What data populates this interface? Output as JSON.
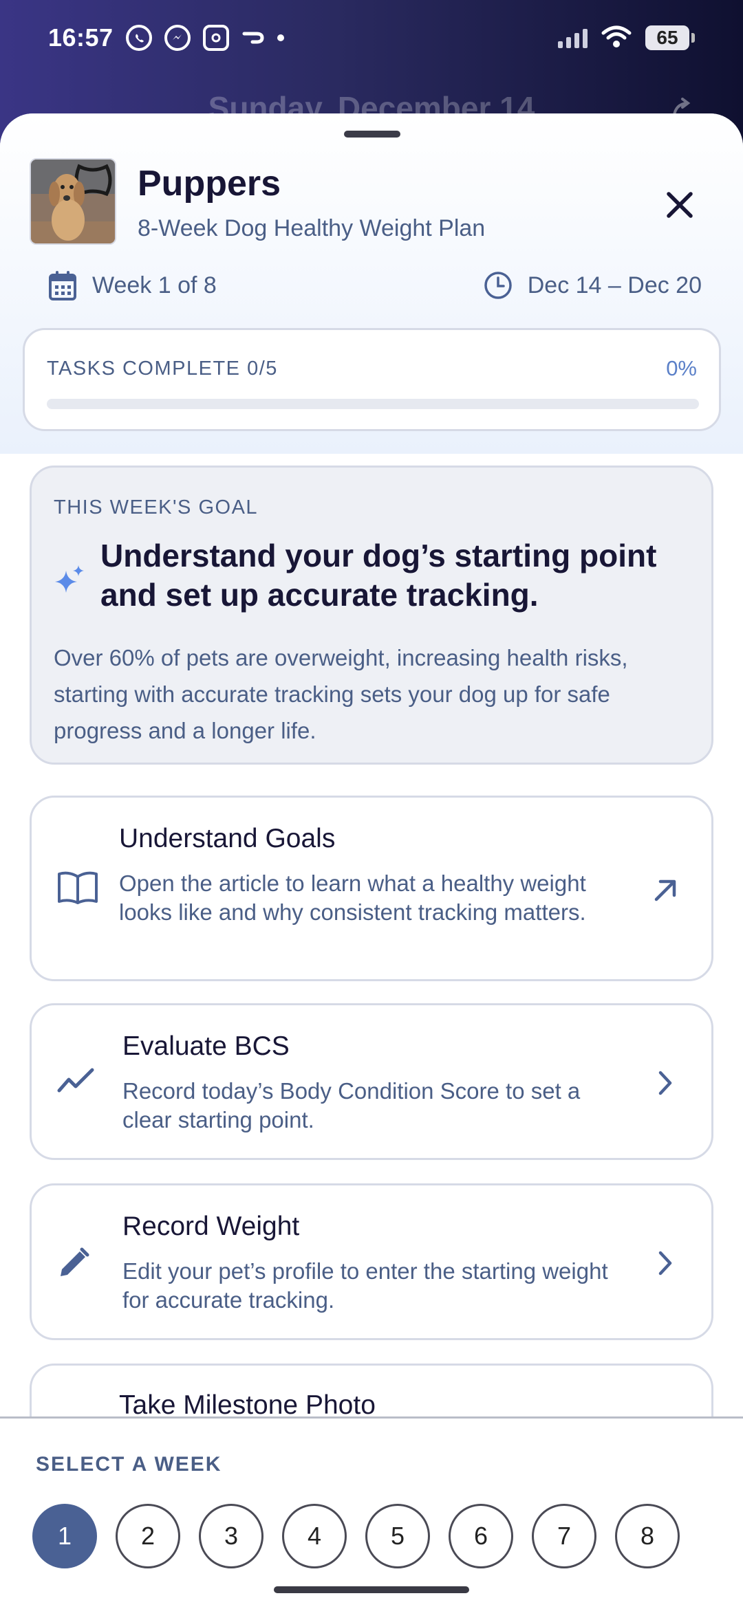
{
  "status_bar": {
    "time": "16:57",
    "battery": "65",
    "app_icons": [
      "whatsapp-icon",
      "messenger-icon",
      "instagram-icon",
      "app-icon"
    ]
  },
  "background": {
    "date": "Sunday, December 14"
  },
  "header": {
    "pet_name": "Puppers",
    "plan_name": "8-Week Dog Healthy Weight Plan",
    "week_label": "Week 1 of 8",
    "date_range": "Dec 14 – Dec 20"
  },
  "progress": {
    "label": "TASKS COMPLETE 0/5",
    "percent_label": "0%",
    "fraction": 0
  },
  "goal": {
    "kicker": "THIS WEEK'S GOAL",
    "title": "Understand your dog’s starting point and set up accurate tracking.",
    "description": "Over 60% of pets are overweight, increasing health risks, starting with accurate tracking sets your dog up for safe progress and a longer life."
  },
  "tasks": [
    {
      "title": "Understand Goals",
      "description": "Open the article to learn what a healthy weight looks like and why consistent tracking matters.",
      "icon": "book-icon",
      "action": "external-link-icon"
    },
    {
      "title": "Evaluate BCS",
      "description": "Record today’s Body Condition Score to set a clear starting point.",
      "icon": "trend-icon",
      "action": "chevron-right-icon"
    },
    {
      "title": "Record Weight",
      "description": "Edit your pet’s profile to enter the starting weight for accurate tracking.",
      "icon": "pencil-icon",
      "action": "chevron-right-icon"
    },
    {
      "title": "Take Milestone Photo",
      "description": "",
      "icon": "camera-icon",
      "action": "chevron-right-icon"
    }
  ],
  "week_selector": {
    "label": "SELECT A WEEK",
    "weeks": [
      "1",
      "2",
      "3",
      "4",
      "5",
      "6",
      "7",
      "8"
    ],
    "selected": "1"
  },
  "colors": {
    "accent": "#4a6194",
    "muted_text": "#4a5e86",
    "percent": "#5b80c8",
    "sparkle": "#5b8be8"
  }
}
